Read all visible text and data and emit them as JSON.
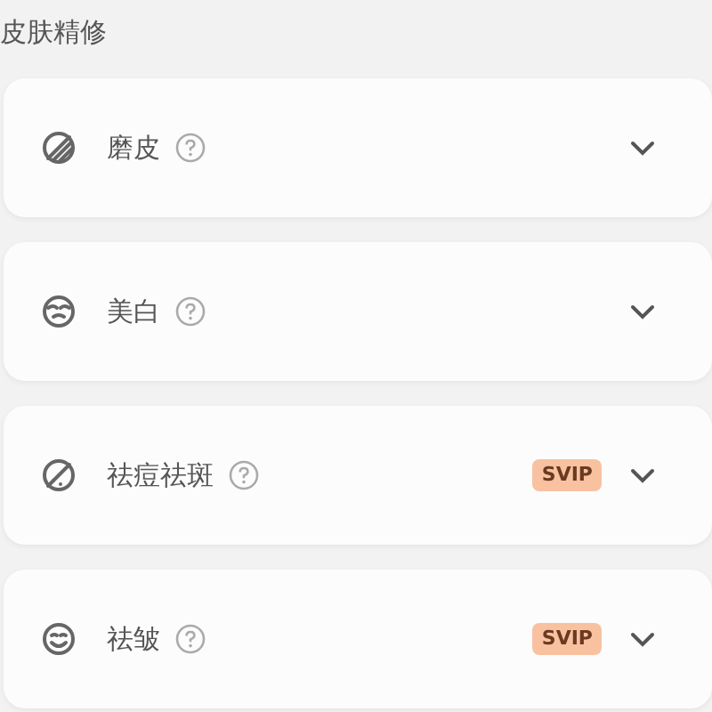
{
  "section_title": "皮肤精修",
  "items": [
    {
      "kind": "smooth",
      "label": "磨皮"
    },
    {
      "kind": "whiten",
      "label": "美白"
    },
    {
      "kind": "blemish",
      "label": "祛痘祛斑",
      "badge": "SVIP"
    },
    {
      "kind": "wrinkle",
      "label": "祛皱",
      "badge": "SVIP"
    }
  ]
}
